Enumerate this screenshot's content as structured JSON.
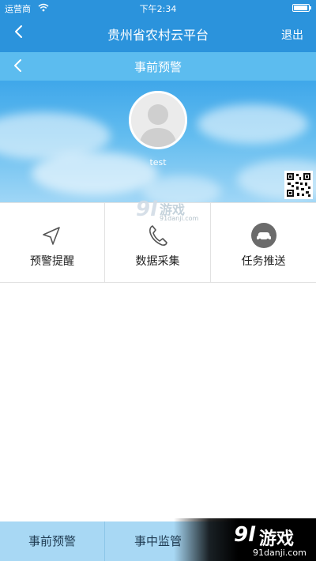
{
  "status_bar": {
    "carrier": "运营商",
    "time": "下午2:34"
  },
  "nav": {
    "title": "贵州省农村云平台",
    "exit_label": "退出"
  },
  "subnav": {
    "title": "事前预警"
  },
  "profile": {
    "username": "test"
  },
  "features": [
    {
      "label": "预警提醒",
      "icon": "navigation-arrow-icon"
    },
    {
      "label": "数据采集",
      "icon": "phone-icon"
    },
    {
      "label": "任务推送",
      "icon": "car-icon"
    }
  ],
  "tabs": [
    {
      "label": "事前预警"
    },
    {
      "label": "事中监管"
    }
  ],
  "watermark": {
    "logo": "9l",
    "text": "游戏",
    "url": "91danji.com"
  },
  "colors": {
    "nav_blue": "#2b93dc",
    "subnav_blue": "#5cbcef",
    "tabbar": "#a8d8f4"
  }
}
